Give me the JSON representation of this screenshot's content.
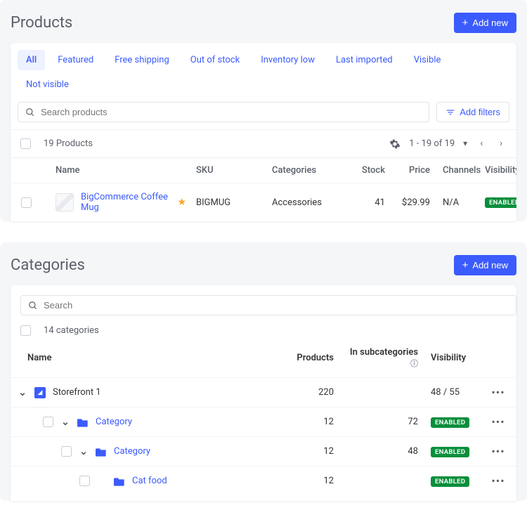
{
  "products": {
    "title": "Products",
    "add_new": "Add new",
    "tabs": [
      "All",
      "Featured",
      "Free shipping",
      "Out of stock",
      "Inventory low",
      "Last imported",
      "Visible",
      "Not visible"
    ],
    "search_placeholder": "Search products",
    "add_filters": "Add filters",
    "count_label": "19 Products",
    "pager": "1 - 19 of 19",
    "headers": {
      "name": "Name",
      "sku": "SKU",
      "categories": "Categories",
      "stock": "Stock",
      "price": "Price",
      "channels": "Channels",
      "visibility": "Visibility"
    },
    "rows": [
      {
        "name": "BigCommerce Coffee Mug",
        "sku": "BIGMUG",
        "categories": "Accessories",
        "stock": "41",
        "price": "$29.99",
        "channels": "N/A",
        "visibility": "ENABLED",
        "starred": true
      }
    ]
  },
  "categories": {
    "title": "Categories",
    "add_new": "Add new",
    "search_placeholder": "Search",
    "count_label": "14 categories",
    "headers": {
      "name": "Name",
      "products": "Products",
      "subcategories": "In subcategories",
      "visibility": "Visibility"
    },
    "rows": [
      {
        "level": 0,
        "type": "storefront",
        "name": "Storefront 1",
        "products": "220",
        "sub": "",
        "visibility_text": "48 / 55",
        "expandable": true
      },
      {
        "level": 1,
        "type": "folder",
        "name": "Category",
        "products": "12",
        "sub": "72",
        "visibility": "ENABLED",
        "checkbox": true,
        "expandable": true
      },
      {
        "level": 2,
        "type": "folder",
        "name": "Category",
        "products": "12",
        "sub": "48",
        "visibility": "ENABLED",
        "checkbox": true,
        "expandable": true
      },
      {
        "level": 3,
        "type": "folder",
        "name": "Cat food",
        "products": "12",
        "sub": "",
        "visibility": "ENABLED",
        "checkbox": true,
        "expandable": false
      }
    ]
  }
}
